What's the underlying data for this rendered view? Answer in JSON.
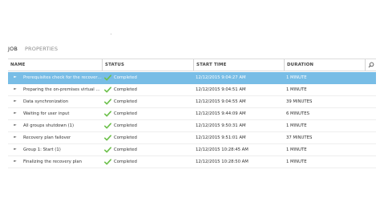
{
  "tabs": [
    {
      "label": "JOB"
    },
    {
      "label": "PROPERTIES"
    }
  ],
  "table": {
    "columns": {
      "name": "NAME",
      "status": "STATUS",
      "start_time": "START TIME",
      "duration": "DURATION"
    },
    "rows": [
      {
        "name": "Prerequisites check for the recovery pl...",
        "status": "Completed",
        "start_time": "12/12/2015 9:04:27 AM",
        "duration": "1 MINUTE"
      },
      {
        "name": "Preparing the on-premises virtual mac...",
        "status": "Completed",
        "start_time": "12/12/2015 9:04:51 AM",
        "duration": "1 MINUTE"
      },
      {
        "name": "Data synchronization",
        "status": "Completed",
        "start_time": "12/12/2015 9:04:55 AM",
        "duration": "39 MINUTES"
      },
      {
        "name": "Waiting for user input",
        "status": "Completed",
        "start_time": "12/12/2015 9:44:09 AM",
        "duration": "6 MINUTES"
      },
      {
        "name": "All groups shutdown (1)",
        "status": "Completed",
        "start_time": "12/12/2015 9:50:31 AM",
        "duration": "1 MINUTE"
      },
      {
        "name": "Recovery plan failover",
        "status": "Completed",
        "start_time": "12/12/2015 9:51:01 AM",
        "duration": "37 MINUTES"
      },
      {
        "name": "Group 1: Start (1)",
        "status": "Completed",
        "start_time": "12/12/2015 10:28:45 AM",
        "duration": "1 MINUTE"
      },
      {
        "name": "Finalizing the recovery plan",
        "status": "Completed",
        "start_time": "12/12/2015 10:28:50 AM",
        "duration": "1 MINUTE"
      }
    ]
  },
  "colors": {
    "selected_row": "#78bde6",
    "check_green": "#6cc04a"
  },
  "icons": {
    "search": "search-icon",
    "check": "check-icon",
    "expand": "expand-arrow-icon"
  }
}
